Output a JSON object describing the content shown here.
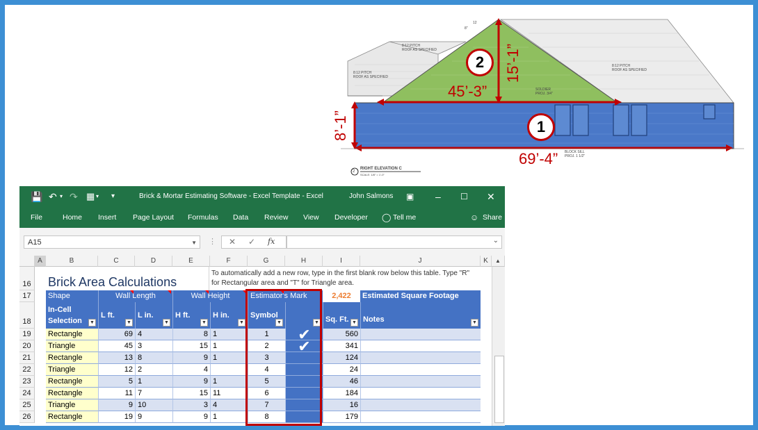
{
  "drawing": {
    "pitch_note_left": "8:12 PITCH\nROOF AS SPECIFIED",
    "pitch_note_top": "8:12 PITCH\nROOF AS SPECIFIED",
    "pitch_note_right": "8:12 PITCH\nROOF AS SPECIFIED",
    "pitch_12": "12",
    "pitch_8": "8\"",
    "soldier_note": "SOLDIER\nPROJ. 3/4\"",
    "sill_note": "BLOCK SILL\nPROJ. 1 1/2\"",
    "elevation_number": "2",
    "elevation_label": "RIGHT ELEVATION C",
    "elevation_scale": "SCALE: 1/8\" = 1'-0\"",
    "area1_badge": "1",
    "area2_badge": "2",
    "dim_wall_height": "8’-1”",
    "dim_wall_length": "69’-4”",
    "dim_gable_height": "15’-1”",
    "dim_gable_base": "45’-3”"
  },
  "excel": {
    "title": "Brick & Mortar Estimating Software - Excel Template  -  Excel",
    "user": "John Salmons",
    "menu": [
      "File",
      "Home",
      "Insert",
      "Page Layout",
      "Formulas",
      "Data",
      "Review",
      "View",
      "Developer"
    ],
    "tell_me": "Tell me",
    "share": "Share",
    "name_box": "A15",
    "columns": [
      "A",
      "B",
      "C",
      "D",
      "E",
      "F",
      "G",
      "H",
      "I",
      "J",
      "K"
    ],
    "row16": "16",
    "row17": "17",
    "row18": "18",
    "sheet_title": "Brick Area Calculations",
    "instruction": "To automatically add a new row, type in the first blank row below this table. Type \"R\" for Rectangular area and \"T\" for Triangle area.",
    "group_headers": {
      "shape": "Shape",
      "wall_length": "Wall Length",
      "wall_height": "Wall Height",
      "estimators_mark": "Estimator's Mark",
      "total": "2,422",
      "est_sq_ft": "Estimated Square Footage"
    },
    "col_headers": {
      "in_cell": "In-Cell",
      "selection": "Selection",
      "l_ft": "L ft.",
      "l_in": "L in.",
      "h_ft": "H ft.",
      "h_in": "H in.",
      "symbol": "Symbol",
      "sq_ft": "Sq. Ft.",
      "notes": "Notes"
    },
    "rows": [
      {
        "row": "19",
        "shape": "Rectangle",
        "lft": "69",
        "lin": "4",
        "hft": "8",
        "hin": "1",
        "symbol": "1",
        "mark": "check",
        "sqft": "560"
      },
      {
        "row": "20",
        "shape": "Triangle",
        "lft": "45",
        "lin": "3",
        "hft": "15",
        "hin": "1",
        "symbol": "2",
        "mark": "check",
        "sqft": "341"
      },
      {
        "row": "21",
        "shape": "Rectangle",
        "lft": "13",
        "lin": "8",
        "hft": "9",
        "hin": "1",
        "symbol": "3",
        "mark": "",
        "sqft": "124"
      },
      {
        "row": "22",
        "shape": "Triangle",
        "lft": "12",
        "lin": "2",
        "hft": "4",
        "hin": "",
        "symbol": "4",
        "mark": "",
        "sqft": "24"
      },
      {
        "row": "23",
        "shape": "Rectangle",
        "lft": "5",
        "lin": "1",
        "hft": "9",
        "hin": "1",
        "symbol": "5",
        "mark": "",
        "sqft": "46"
      },
      {
        "row": "24",
        "shape": "Rectangle",
        "lft": "11",
        "lin": "7",
        "hft": "15",
        "hin": "11",
        "symbol": "6",
        "mark": "",
        "sqft": "184"
      },
      {
        "row": "25",
        "shape": "Triangle",
        "lft": "9",
        "lin": "10",
        "hft": "3",
        "hin": "4",
        "symbol": "7",
        "mark": "",
        "sqft": "16"
      },
      {
        "row": "26",
        "shape": "Rectangle",
        "lft": "19",
        "lin": "9",
        "hft": "9",
        "hin": "1",
        "symbol": "8",
        "mark": "",
        "sqft": "179"
      }
    ]
  },
  "colors": {
    "frame": "#3d8fd4",
    "excel_green": "#217346",
    "table_blue": "#4472c4",
    "band_light": "#d9e1f2",
    "shape_yellow": "#ffffcc",
    "highlight_red": "#c00000",
    "total_orange": "#ed7d31",
    "gable_green": "#8fbf5f",
    "wall_blue": "#4a78c8"
  }
}
